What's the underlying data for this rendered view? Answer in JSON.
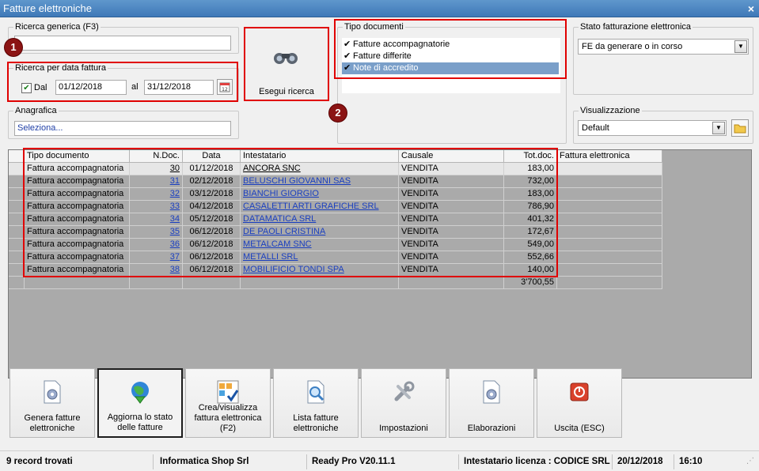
{
  "window": {
    "title": "Fatture elettroniche",
    "close_glyph": "×"
  },
  "ricerca_generica": {
    "legend": "Ricerca generica (F3)",
    "value": ""
  },
  "ricerca_data": {
    "legend": "Ricerca per data fattura",
    "dal_label": "Dal",
    "dal_checked": true,
    "dal_value": "01/12/2018",
    "al_label": "al",
    "al_value": "31/12/2018"
  },
  "anagrafica": {
    "legend": "Anagrafica",
    "value": "Seleziona..."
  },
  "esegui": {
    "label": "Esegui ricerca",
    "icon": "binoculars-icon"
  },
  "tipo_documenti": {
    "legend": "Tipo documenti",
    "items": [
      {
        "label": "Fatture accompagnatorie",
        "checked": true,
        "selected": false
      },
      {
        "label": "Fatture differite",
        "checked": true,
        "selected": false
      },
      {
        "label": "Note di accredito",
        "checked": true,
        "selected": true
      }
    ]
  },
  "stato": {
    "legend": "Stato fatturazione elettronica",
    "value": "FE da generare o in corso"
  },
  "visualizzazione": {
    "legend": "Visualizzazione",
    "value": "Default"
  },
  "badges": [
    "1",
    "2"
  ],
  "table": {
    "columns": [
      "Tipo documento",
      "N.Doc.",
      "Data",
      "Intestatario",
      "Causale",
      "Tot.doc.",
      "Fattura elettronica"
    ],
    "rows": [
      [
        "Fattura accompagnatoria",
        "30",
        "01/12/2018",
        "ANCORA SNC",
        "VENDITA",
        "183,00",
        ""
      ],
      [
        "Fattura accompagnatoria",
        "31",
        "02/12/2018",
        "BELUSCHI GIOVANNI SAS",
        "VENDITA",
        "732,00",
        ""
      ],
      [
        "Fattura accompagnatoria",
        "32",
        "03/12/2018",
        "BIANCHI GIORGIO",
        "VENDITA",
        "183,00",
        ""
      ],
      [
        "Fattura accompagnatoria",
        "33",
        "04/12/2018",
        "CASALETTI ARTI GRAFICHE SRL",
        "VENDITA",
        "786,90",
        ""
      ],
      [
        "Fattura accompagnatoria",
        "34",
        "05/12/2018",
        "DATAMATICA SRL",
        "VENDITA",
        "401,32",
        ""
      ],
      [
        "Fattura accompagnatoria",
        "35",
        "06/12/2018",
        "DE PAOLI CRISTINA",
        "VENDITA",
        "172,67",
        ""
      ],
      [
        "Fattura accompagnatoria",
        "36",
        "06/12/2018",
        "METALCAM SNC",
        "VENDITA",
        "549,00",
        ""
      ],
      [
        "Fattura accompagnatoria",
        "37",
        "06/12/2018",
        "METALLI SRL",
        "VENDITA",
        "552,66",
        ""
      ],
      [
        "Fattura accompagnatoria",
        "38",
        "06/12/2018",
        "MOBILIFICIO TONDI SPA",
        "VENDITA",
        "140,00",
        ""
      ]
    ],
    "total": "3'700,55"
  },
  "buttons": [
    {
      "label": "Genera fatture elettroniche",
      "icon": "gear-document-icon"
    },
    {
      "label": "Aggiorna lo stato delle fatture",
      "icon": "globe-download-icon"
    },
    {
      "label": "Crea/visualizza fattura elettronica (F2)",
      "icon": "checklist-icon"
    },
    {
      "label": "Lista fatture elettroniche",
      "icon": "search-document-icon"
    },
    {
      "label": "Impostazioni",
      "icon": "wrench-icon"
    },
    {
      "label": "Elaborazioni",
      "icon": "gear-document-icon"
    },
    {
      "label": "Uscita (ESC)",
      "icon": "power-icon"
    }
  ],
  "status": {
    "records": "9 record trovati",
    "company": "Informatica Shop Srl",
    "version": "Ready Pro V20.11.1",
    "license": "Intestatario licenza : CODICE SRL",
    "date": "20/12/2018",
    "time": "16:10"
  }
}
